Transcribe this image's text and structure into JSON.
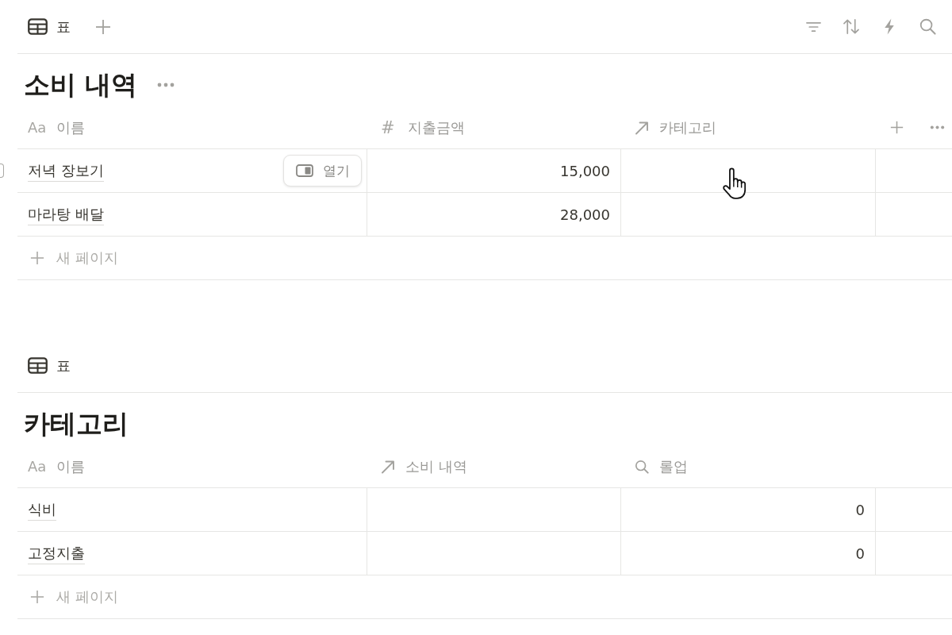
{
  "tables": [
    {
      "view_tabs": [
        {
          "label": "표"
        }
      ],
      "add_view": true,
      "tools": true,
      "title": "소비 내역",
      "title_menu": true,
      "columns": [
        {
          "kind": "title",
          "icon_text": "Aa",
          "name": "이름"
        },
        {
          "kind": "number",
          "icon_text": "#",
          "name": "지출금액"
        },
        {
          "kind": "relation",
          "name": "카테고리"
        }
      ],
      "column_actions": true,
      "rows": [
        {
          "title": "저녁 장보기",
          "number": "15,000",
          "hovered": true,
          "checked": false,
          "open_button": "열기"
        },
        {
          "title": "마라탕 배달",
          "number": "28,000",
          "hovered": false
        }
      ],
      "new_row": "새 페이지"
    },
    {
      "view_tabs": [
        {
          "label": "표"
        }
      ],
      "title": "카테고리",
      "columns": [
        {
          "kind": "title",
          "icon_text": "Aa",
          "name": "이름"
        },
        {
          "kind": "relation",
          "name": "소비 내역"
        },
        {
          "kind": "rollup",
          "name": "롤업"
        }
      ],
      "rows": [
        {
          "title": "식비",
          "rollup": "0",
          "hovered": false
        },
        {
          "title": "고정지출",
          "rollup": "0",
          "hovered": false
        }
      ],
      "new_row": "새 페이지"
    }
  ]
}
